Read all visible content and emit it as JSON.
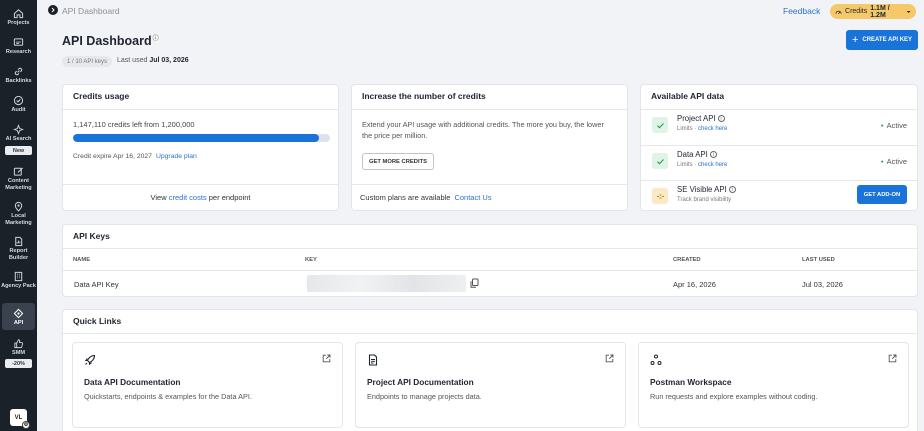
{
  "sidebar": {
    "items": [
      {
        "label": "Projects",
        "icon": "home-icon"
      },
      {
        "label": "Research",
        "icon": "research-icon"
      },
      {
        "label": "Backlinks",
        "icon": "link-icon"
      },
      {
        "label": "Audit",
        "icon": "check-circle-icon"
      },
      {
        "label": "AI Search",
        "icon": "sparkle-icon"
      },
      {
        "label": "Content Marketing",
        "icon": "edit-icon"
      },
      {
        "label": "Local Marketing",
        "icon": "pin-icon"
      },
      {
        "label": "Report Builder",
        "icon": "report-icon"
      },
      {
        "label": "Agency Pack",
        "icon": "building-icon"
      },
      {
        "label": "API",
        "icon": "api-icon"
      },
      {
        "label": "SMM",
        "icon": "thumbs-up-icon"
      }
    ],
    "ai_search_badge": "New",
    "smm_badge": "-20%",
    "avatar_initials": "VL"
  },
  "topbar": {
    "breadcrumb": "API Dashboard",
    "feedback": "Feedback",
    "credits_label": "Credits",
    "credits_amount": "1.1M / 1.2M"
  },
  "header": {
    "title": "API Dashboard",
    "keys_badge": "1 / 10 API keys",
    "last_used_label": "Last used",
    "last_used_date": "Jul 03, 2026",
    "create_button": "CREATE API KEY"
  },
  "credits_usage": {
    "title": "Credits usage",
    "left_text": "1,147,110 credits left from 1,200,000",
    "progress_fraction": 0.956,
    "expire_text": "Credit expire Apr 16, 2027",
    "upgrade_link": "Upgrade plan",
    "footer_prefix": "View",
    "footer_link": "credit costs",
    "footer_suffix": "per endpoint"
  },
  "increase_credits": {
    "title": "Increase the number of credits",
    "text": "Extend your API usage with additional credits. The more you buy, the lower the price per million.",
    "button": "GET MORE CREDITS",
    "custom_text": "Custom plans are available",
    "contact_link": "Contact Us"
  },
  "available_api": {
    "title": "Available API data",
    "items": [
      {
        "name": "Project API",
        "sub_prefix": "Limits ·",
        "sub_link": "check here",
        "status": "Active"
      },
      {
        "name": "Data API",
        "sub_prefix": "Limits ·",
        "sub_link": "check here",
        "status": "Active"
      },
      {
        "name": "SE Visible API",
        "sub": "Track brand visibility",
        "button": "GET ADD-ON"
      }
    ]
  },
  "api_keys": {
    "title": "API Keys",
    "columns": [
      "NAME",
      "KEY",
      "CREATED",
      "LAST USED"
    ],
    "rows": [
      {
        "name": "Data API Key",
        "created": "Apr 16, 2026",
        "last_used": "Jul 03, 2026"
      }
    ]
  },
  "quick_links": {
    "title": "Quick Links",
    "items": [
      {
        "title": "Data API Documentation",
        "desc": "Quickstarts, endpoints & examples for the Data API.",
        "icon": "rocket-icon"
      },
      {
        "title": "Project API Documentation",
        "desc": "Endpoints to manage projects data.",
        "icon": "document-icon"
      },
      {
        "title": "Postman Workspace",
        "desc": "Run requests and explore examples without coding.",
        "icon": "nodes-icon"
      }
    ]
  },
  "colors": {
    "accent": "#1a73d9",
    "sidebar": "#1b2128",
    "credits_pill": "#f5c86a",
    "active_green": "#2a9a4f"
  }
}
